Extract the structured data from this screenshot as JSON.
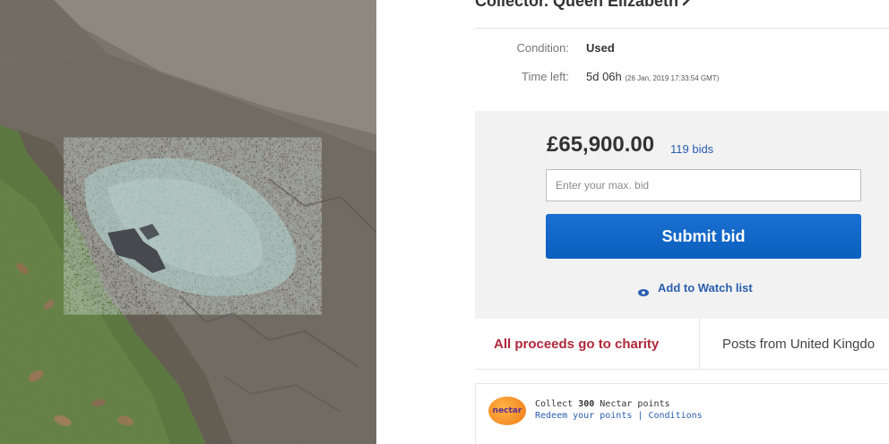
{
  "listing": {
    "title": "Collector. Queen Elizabeth",
    "title_icon": "hammer-icon",
    "condition_label": "Condition:",
    "condition_value": "Used",
    "time_left_label": "Time left:",
    "time_left_value": "5d 06h",
    "time_left_detail": "(26 Jan, 2019  17:33:54 GMT)",
    "price": "£65,900.00",
    "bids": "119 bids",
    "bid_placeholder": "Enter your max. bid",
    "submit_label": "Submit bid",
    "watch_label": "Add to Watch list",
    "watch_icon": "eye-icon",
    "charity_label": "All proceeds go to charity",
    "posts_label": "Posts from United Kingdo",
    "nectar": {
      "logo_text": "nectar",
      "collect_prefix": "Collect",
      "collect_points": "300",
      "collect_suffix": "Nectar points",
      "redeem": "Redeem your points",
      "separator": "|",
      "conditions": "Conditions"
    }
  },
  "colors": {
    "link": "#2a5db0",
    "charity": "#b0283c",
    "button": "#0b5fbf",
    "bid_panel": "#f2f2f2",
    "nectar_orange": "#f07a16"
  }
}
